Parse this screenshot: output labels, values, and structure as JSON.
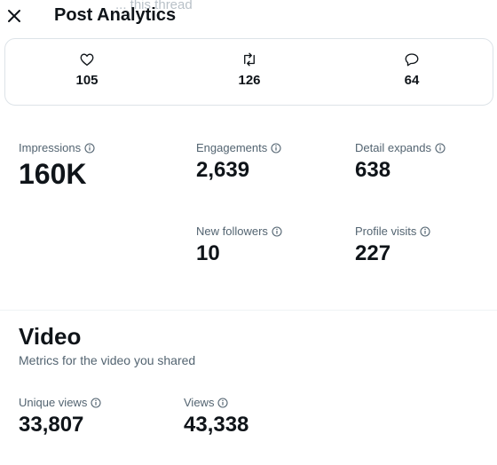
{
  "header": {
    "title": "Post Analytics",
    "behind_text": "... this thread"
  },
  "engagements": {
    "likes": "105",
    "reposts": "126",
    "replies": "64"
  },
  "metrics": {
    "impressions": {
      "label": "Impressions",
      "value": "160K"
    },
    "engagements": {
      "label": "Engagements",
      "value": "2,639"
    },
    "detail_expands": {
      "label": "Detail expands",
      "value": "638"
    },
    "new_followers": {
      "label": "New followers",
      "value": "10"
    },
    "profile_visits": {
      "label": "Profile visits",
      "value": "227"
    }
  },
  "video": {
    "title": "Video",
    "subtitle": "Metrics for the video you shared",
    "unique_views": {
      "label": "Unique views",
      "value": "33,807"
    },
    "views": {
      "label": "Views",
      "value": "43,338"
    }
  },
  "icons": {
    "close": "close-icon",
    "like": "heart-icon",
    "repost": "repost-icon",
    "reply": "reply-icon",
    "info": "info-icon"
  },
  "colors": {
    "text": "#0f1419",
    "secondary": "#536471",
    "border": "#dde3e8"
  }
}
